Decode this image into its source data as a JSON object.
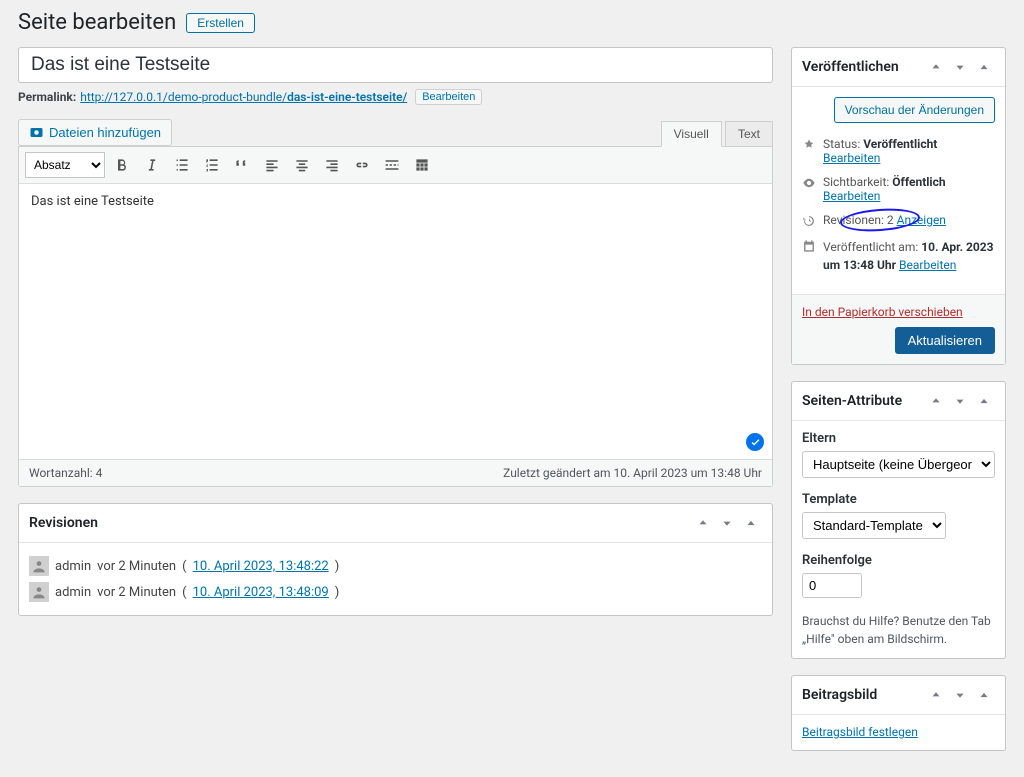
{
  "header": {
    "title": "Seite bearbeiten",
    "create_label": "Erstellen"
  },
  "post": {
    "title_value": "Das ist eine Testseite",
    "permalink_label": "Permalink:",
    "permalink_base": "http://127.0.0.1/demo-product-bundle/",
    "permalink_slug": "das-ist-eine-testseite/",
    "edit_label": "Bearbeiten"
  },
  "media_button_label": "Dateien hinzufügen",
  "editor": {
    "tab_visual": "Visuell",
    "tab_text": "Text",
    "format_select_label": "Absatz",
    "content": "Das ist eine Testseite",
    "wordcount_label": "Wortanzahl:",
    "wordcount_value": "4",
    "last_modified": "Zuletzt geändert am 10. April 2023 um 13:48 Uhr"
  },
  "revisions_box": {
    "title": "Revisionen",
    "items": [
      {
        "author": "admin",
        "ago": "vor 2 Minuten",
        "timestamp": "10. April 2023, 13:48:22"
      },
      {
        "author": "admin",
        "ago": "vor 2 Minuten",
        "timestamp": "10. April 2023, 13:48:09"
      }
    ]
  },
  "publish_box": {
    "title": "Veröffentlichen",
    "preview_label": "Vorschau der Änderungen",
    "status_label": "Status:",
    "status_value": "Veröffentlicht",
    "status_edit": "Bearbeiten",
    "visibility_label": "Sichtbarkeit:",
    "visibility_value": "Öffentlich",
    "visibility_edit": "Bearbeiten",
    "revisions_label": "Revisionen:",
    "revisions_count": "2",
    "revisions_link": "Anzeigen",
    "published_prefix": "Veröffentlicht am:",
    "published_value": "10. Apr. 2023 um 13:48 Uhr",
    "published_edit": "Bearbeiten",
    "trash_label": "In den Papierkorb verschieben",
    "update_label": "Aktualisieren"
  },
  "attributes_box": {
    "title": "Seiten-Attribute",
    "parent_label": "Eltern",
    "parent_value": "Hauptseite (keine Übergeordnete)",
    "template_label": "Template",
    "template_value": "Standard-Template",
    "order_label": "Reihenfolge",
    "order_value": "0",
    "help_text": "Brauchst du Hilfe? Benutze den Tab „Hilfe\" oben am Bildschirm."
  },
  "featured_box": {
    "title": "Beitragsbild",
    "link_label": "Beitragsbild festlegen"
  }
}
